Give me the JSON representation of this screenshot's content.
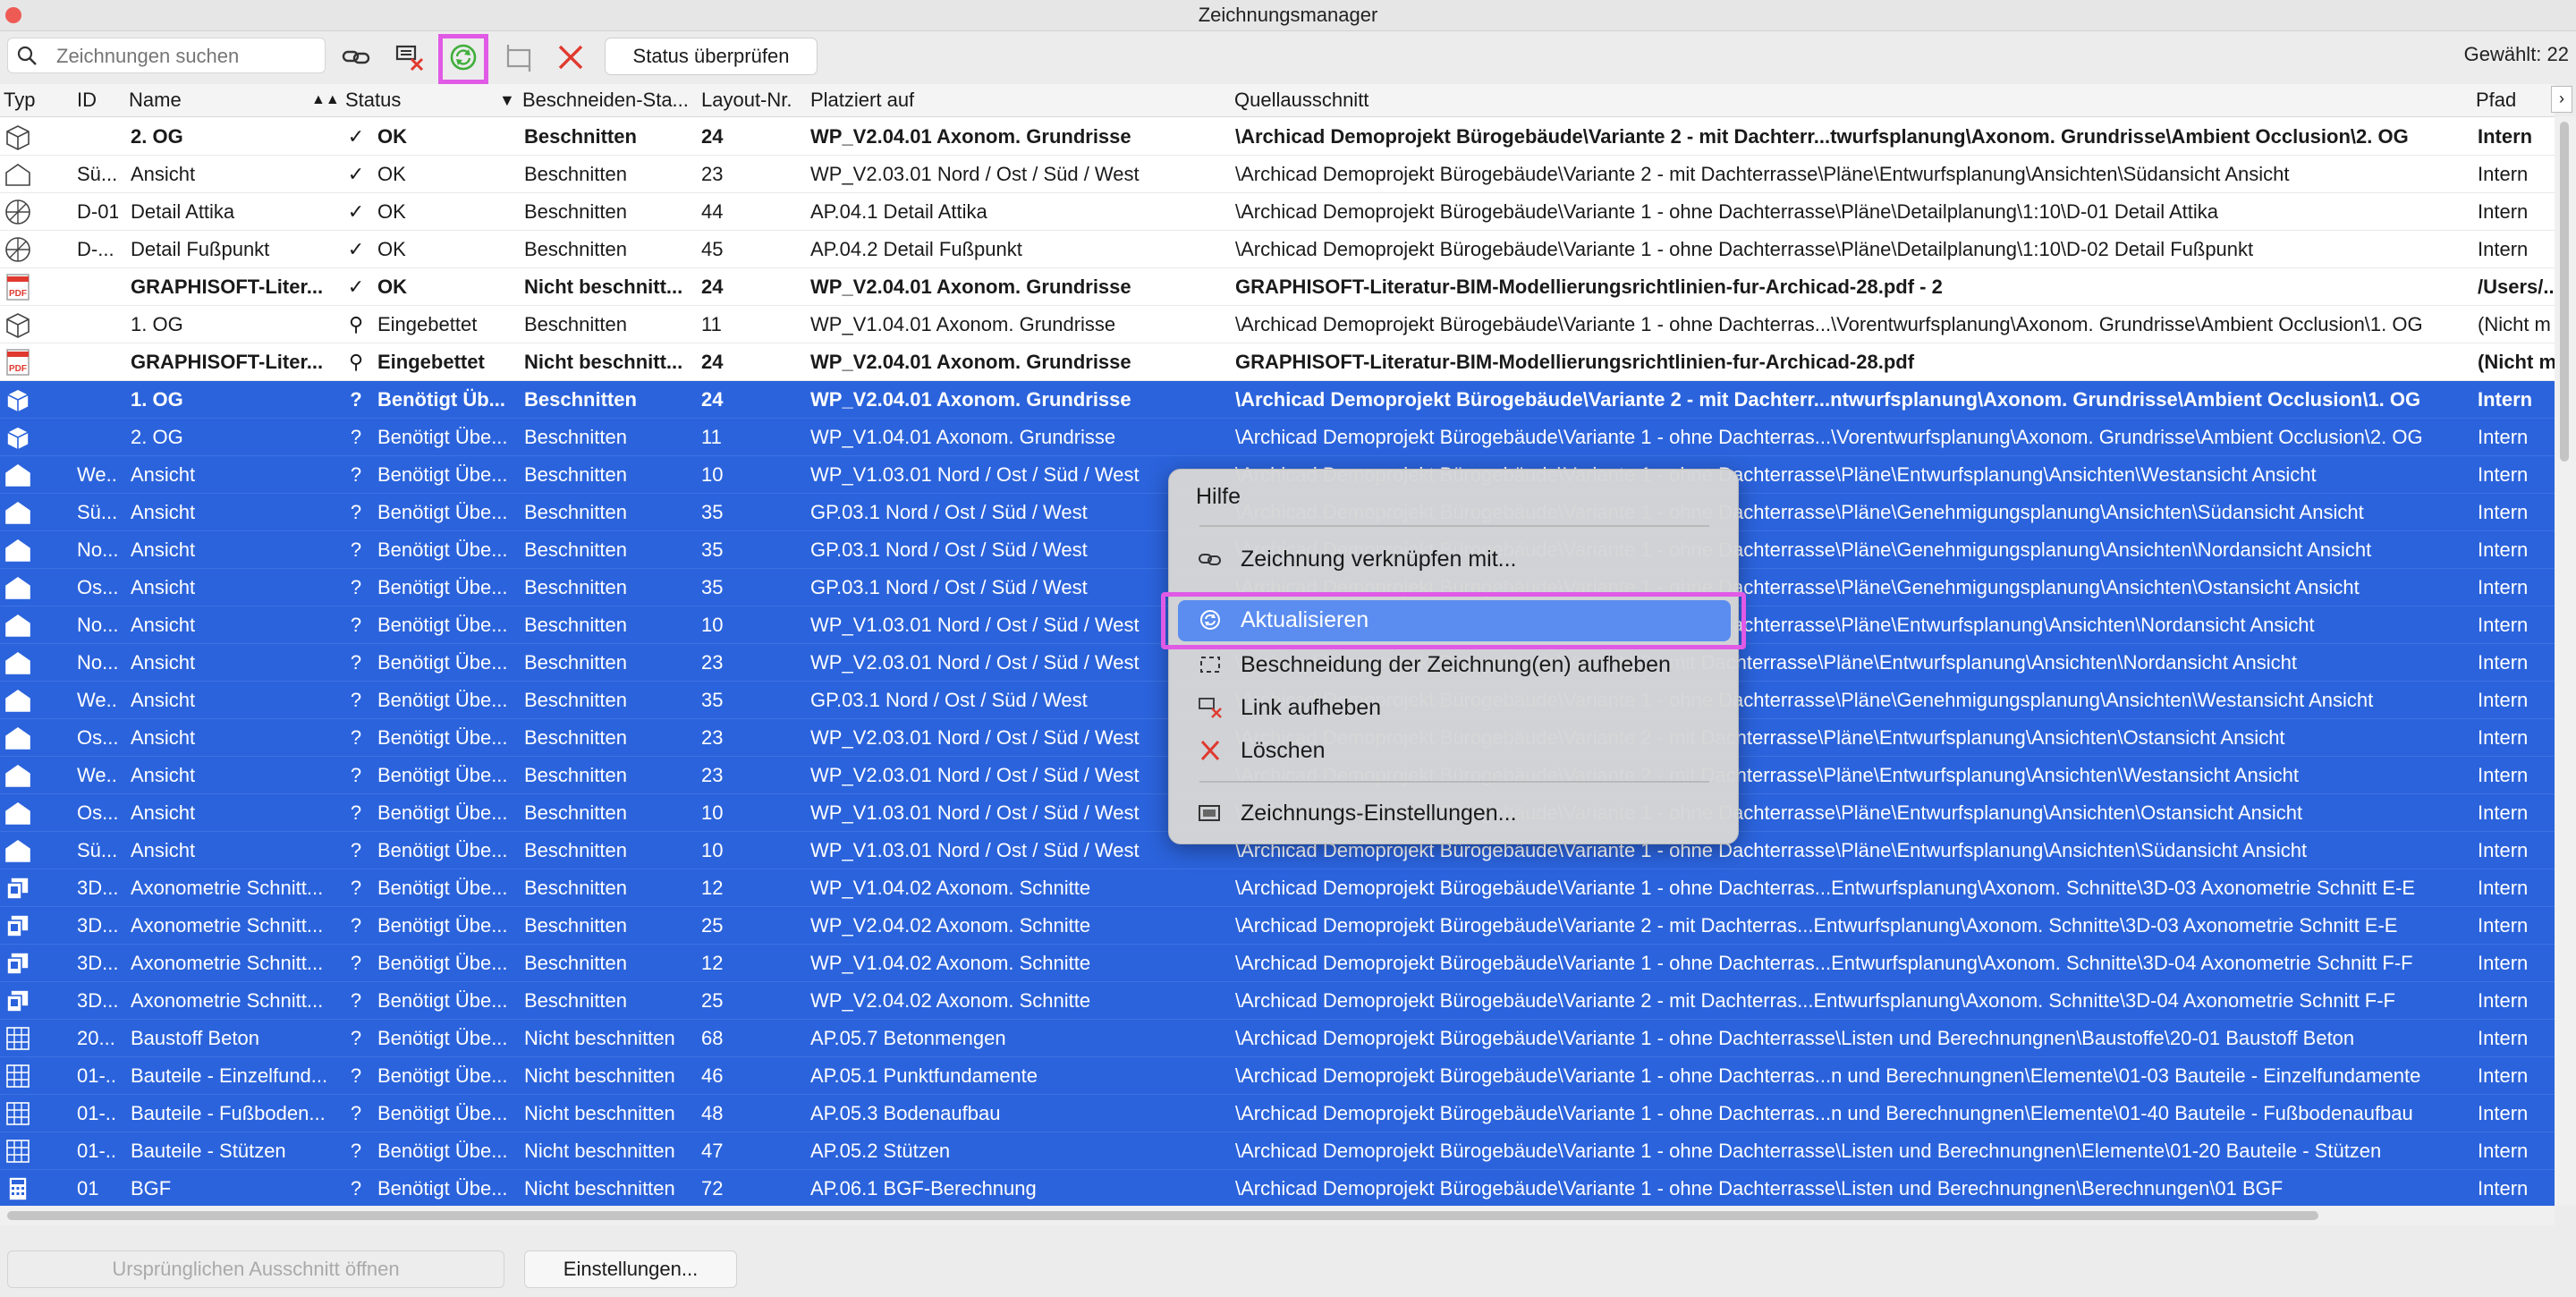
{
  "window": {
    "title": "Zeichnungsmanager"
  },
  "toolbar": {
    "search_placeholder": "Zeichnungen suchen",
    "status_button": "Status überprüfen",
    "selected_label": "Gewählt: 22"
  },
  "columns": {
    "typ": "Typ",
    "id": "ID",
    "name": "Name",
    "status": "Status",
    "beschneiden": "Beschneiden-Sta...",
    "layout": "Layout-Nr.",
    "platziert": "Platziert auf",
    "quelle": "Quellausschnitt",
    "pfad": "Pfad"
  },
  "rows": [
    {
      "type": "axo",
      "id": "",
      "name": "2. OG",
      "st": "check",
      "status": "OK",
      "besch": "Beschnitten",
      "layout": "24",
      "plaz": "WP_V2.04.01 Axonom. Grundrisse",
      "quelle": "\\Archicad Demoprojekt Bürogebäude\\Variante 2 - mit Dachterr...twurfsplanung\\Axonom. Grundrisse\\Ambient Occlusion\\2. OG",
      "pfad": "Intern",
      "bold": true,
      "sel": false
    },
    {
      "type": "elev",
      "id": "Sü...",
      "name": "Ansicht",
      "st": "check",
      "status": "OK",
      "besch": "Beschnitten",
      "layout": "23",
      "plaz": "WP_V2.03.01 Nord / Ost / Süd / West",
      "quelle": "\\Archicad Demoprojekt Bürogebäude\\Variante 2 - mit Dachterrasse\\Pläne\\Entwurfsplanung\\Ansichten\\Südansicht Ansicht",
      "pfad": "Intern",
      "bold": false,
      "sel": false
    },
    {
      "type": "detail",
      "id": "D-01",
      "name": "Detail Attika",
      "st": "check",
      "status": "OK",
      "besch": "Beschnitten",
      "layout": "44",
      "plaz": "AP.04.1 Detail Attika",
      "quelle": "\\Archicad Demoprojekt Bürogebäude\\Variante 1 - ohne Dachterrasse\\Pläne\\Detailplanung\\1:10\\D-01 Detail Attika",
      "pfad": "Intern",
      "bold": false,
      "sel": false
    },
    {
      "type": "detail",
      "id": "D-...",
      "name": "Detail Fußpunkt",
      "st": "check",
      "status": "OK",
      "besch": "Beschnitten",
      "layout": "45",
      "plaz": "AP.04.2 Detail Fußpunkt",
      "quelle": "\\Archicad Demoprojekt Bürogebäude\\Variante 1 - ohne Dachterrasse\\Pläne\\Detailplanung\\1:10\\D-02 Detail Fußpunkt",
      "pfad": "Intern",
      "bold": false,
      "sel": false
    },
    {
      "type": "pdf",
      "id": "",
      "name": "GRAPHISOFT-Liter...",
      "st": "check",
      "status": "OK",
      "besch": "Nicht beschnitt...",
      "layout": "24",
      "plaz": "WP_V2.04.01 Axonom. Grundrisse",
      "quelle": "GRAPHISOFT-Literatur-BIM-Modellierungsrichtlinien-fur-Archicad-28.pdf - 2",
      "pfad": "/Users/...",
      "bold": true,
      "sel": false
    },
    {
      "type": "axo",
      "id": "",
      "name": "1. OG",
      "st": "pin",
      "status": "Eingebettet",
      "besch": "Beschnitten",
      "layout": "11",
      "plaz": "WP_V1.04.01 Axonom. Grundrisse",
      "quelle": "\\Archicad Demoprojekt Bürogebäude\\Variante 1 - ohne Dachterras...\\Vorentwurfsplanung\\Axonom. Grundrisse\\Ambient Occlusion\\1. OG",
      "pfad": "(Nicht m",
      "bold": false,
      "sel": false
    },
    {
      "type": "pdf",
      "id": "",
      "name": "GRAPHISOFT-Liter...",
      "st": "pin",
      "status": "Eingebettet",
      "besch": "Nicht beschnitt...",
      "layout": "24",
      "plaz": "WP_V2.04.01 Axonom. Grundrisse",
      "quelle": "GRAPHISOFT-Literatur-BIM-Modellierungsrichtlinien-fur-Archicad-28.pdf",
      "pfad": "(Nicht m",
      "bold": true,
      "sel": false
    },
    {
      "type": "axo",
      "id": "",
      "name": "1. OG",
      "st": "q",
      "status": "Benötigt Üb...",
      "besch": "Beschnitten",
      "layout": "24",
      "plaz": "WP_V2.04.01 Axonom. Grundrisse",
      "quelle": "\\Archicad Demoprojekt Bürogebäude\\Variante 2 - mit Dachterr...ntwurfsplanung\\Axonom. Grundrisse\\Ambient Occlusion\\1. OG",
      "pfad": "Intern",
      "bold": true,
      "sel": true
    },
    {
      "type": "axo",
      "id": "",
      "name": "2. OG",
      "st": "q",
      "status": "Benötigt Übe...",
      "besch": "Beschnitten",
      "layout": "11",
      "plaz": "WP_V1.04.01 Axonom. Grundrisse",
      "quelle": "\\Archicad Demoprojekt Bürogebäude\\Variante 1 - ohne Dachterras...\\Vorentwurfsplanung\\Axonom. Grundrisse\\Ambient Occlusion\\2. OG",
      "pfad": "Intern",
      "bold": false,
      "sel": true
    },
    {
      "type": "elev",
      "id": "We...",
      "name": "Ansicht",
      "st": "q",
      "status": "Benötigt Übe...",
      "besch": "Beschnitten",
      "layout": "10",
      "plaz": "WP_V1.03.01 Nord / Ost / Süd / West",
      "quelle": "\\Archicad Demoprojekt Bürogebäude\\Variante 1 - ohne Dachterrasse\\Pläne\\Entwurfsplanung\\Ansichten\\Westansicht Ansicht",
      "pfad": "Intern",
      "bold": false,
      "sel": true
    },
    {
      "type": "elev",
      "id": "Sü...",
      "name": "Ansicht",
      "st": "q",
      "status": "Benötigt Übe...",
      "besch": "Beschnitten",
      "layout": "35",
      "plaz": "GP.03.1 Nord / Ost / Süd / West",
      "quelle": "\\Archicad Demoprojekt Bürogebäude\\Variante 1 - ohne Dachterrasse\\Pläne\\Genehmigungsplanung\\Ansichten\\Südansicht Ansicht",
      "pfad": "Intern",
      "bold": false,
      "sel": true
    },
    {
      "type": "elev",
      "id": "No...",
      "name": "Ansicht",
      "st": "q",
      "status": "Benötigt Übe...",
      "besch": "Beschnitten",
      "layout": "35",
      "plaz": "GP.03.1 Nord / Ost / Süd / West",
      "quelle": "\\Archicad Demoprojekt Bürogebäude\\Variante 1 - ohne Dachterrasse\\Pläne\\Genehmigungsplanung\\Ansichten\\Nordansicht Ansicht",
      "pfad": "Intern",
      "bold": false,
      "sel": true
    },
    {
      "type": "elev",
      "id": "Os...",
      "name": "Ansicht",
      "st": "q",
      "status": "Benötigt Übe...",
      "besch": "Beschnitten",
      "layout": "35",
      "plaz": "GP.03.1 Nord / Ost / Süd / West",
      "quelle": "\\Archicad Demoprojekt Bürogebäude\\Variante 1 - ohne Dachterrasse\\Pläne\\Genehmigungsplanung\\Ansichten\\Ostansicht Ansicht",
      "pfad": "Intern",
      "bold": false,
      "sel": true
    },
    {
      "type": "elev",
      "id": "No...",
      "name": "Ansicht",
      "st": "q",
      "status": "Benötigt Übe...",
      "besch": "Beschnitten",
      "layout": "10",
      "plaz": "WP_V1.03.01 Nord / Ost / Süd / West",
      "quelle": "\\Archicad Demoprojekt Bürogebäude\\Variante 1 - ohne Dachterrasse\\Pläne\\Entwurfsplanung\\Ansichten\\Nordansicht Ansicht",
      "pfad": "Intern",
      "bold": false,
      "sel": true
    },
    {
      "type": "elev",
      "id": "No...",
      "name": "Ansicht",
      "st": "q",
      "status": "Benötigt Übe...",
      "besch": "Beschnitten",
      "layout": "23",
      "plaz": "WP_V2.03.01 Nord / Ost / Süd / West",
      "quelle": "\\Archicad Demoprojekt Bürogebäude\\Variante 2 - mit Dachterrasse\\Pläne\\Entwurfsplanung\\Ansichten\\Nordansicht Ansicht",
      "pfad": "Intern",
      "bold": false,
      "sel": true
    },
    {
      "type": "elev",
      "id": "We...",
      "name": "Ansicht",
      "st": "q",
      "status": "Benötigt Übe...",
      "besch": "Beschnitten",
      "layout": "35",
      "plaz": "GP.03.1 Nord / Ost / Süd / West",
      "quelle": "\\Archicad Demoprojekt Bürogebäude\\Variante 1 - ohne Dachterrasse\\Pläne\\Genehmigungsplanung\\Ansichten\\Westansicht Ansicht",
      "pfad": "Intern",
      "bold": false,
      "sel": true
    },
    {
      "type": "elev",
      "id": "Os...",
      "name": "Ansicht",
      "st": "q",
      "status": "Benötigt Übe...",
      "besch": "Beschnitten",
      "layout": "23",
      "plaz": "WP_V2.03.01 Nord / Ost / Süd / West",
      "quelle": "\\Archicad Demoprojekt Bürogebäude\\Variante 2 - mit Dachterrasse\\Pläne\\Entwurfsplanung\\Ansichten\\Ostansicht Ansicht",
      "pfad": "Intern",
      "bold": false,
      "sel": true
    },
    {
      "type": "elev",
      "id": "We...",
      "name": "Ansicht",
      "st": "q",
      "status": "Benötigt Übe...",
      "besch": "Beschnitten",
      "layout": "23",
      "plaz": "WP_V2.03.01 Nord / Ost / Süd / West",
      "quelle": "\\Archicad Demoprojekt Bürogebäude\\Variante 2 - mit Dachterrasse\\Pläne\\Entwurfsplanung\\Ansichten\\Westansicht Ansicht",
      "pfad": "Intern",
      "bold": false,
      "sel": true
    },
    {
      "type": "elev",
      "id": "Os...",
      "name": "Ansicht",
      "st": "q",
      "status": "Benötigt Übe...",
      "besch": "Beschnitten",
      "layout": "10",
      "plaz": "WP_V1.03.01 Nord / Ost / Süd / West",
      "quelle": "\\Archicad Demoprojekt Bürogebäude\\Variante 1 - ohne Dachterrasse\\Pläne\\Entwurfsplanung\\Ansichten\\Ostansicht Ansicht",
      "pfad": "Intern",
      "bold": false,
      "sel": true
    },
    {
      "type": "elev",
      "id": "Sü...",
      "name": "Ansicht",
      "st": "q",
      "status": "Benötigt Übe...",
      "besch": "Beschnitten",
      "layout": "10",
      "plaz": "WP_V1.03.01 Nord / Ost / Süd / West",
      "quelle": "\\Archicad Demoprojekt Bürogebäude\\Variante 1 - ohne Dachterrasse\\Pläne\\Entwurfsplanung\\Ansichten\\Südansicht Ansicht",
      "pfad": "Intern",
      "bold": false,
      "sel": true
    },
    {
      "type": "sect",
      "id": "3D...",
      "name": "Axonometrie Schnitt...",
      "st": "q",
      "status": "Benötigt Übe...",
      "besch": "Beschnitten",
      "layout": "12",
      "plaz": "WP_V1.04.02 Axonom. Schnitte",
      "quelle": "\\Archicad Demoprojekt Bürogebäude\\Variante 1 - ohne Dachterras...Entwurfsplanung\\Axonom. Schnitte\\3D-03 Axonometrie Schnitt E-E",
      "pfad": "Intern",
      "bold": false,
      "sel": true
    },
    {
      "type": "sect",
      "id": "3D...",
      "name": "Axonometrie Schnitt...",
      "st": "q",
      "status": "Benötigt Übe...",
      "besch": "Beschnitten",
      "layout": "25",
      "plaz": "WP_V2.04.02 Axonom. Schnitte",
      "quelle": "\\Archicad Demoprojekt Bürogebäude\\Variante 2 - mit Dachterras...Entwurfsplanung\\Axonom. Schnitte\\3D-03 Axonometrie Schnitt E-E",
      "pfad": "Intern",
      "bold": false,
      "sel": true
    },
    {
      "type": "sect",
      "id": "3D...",
      "name": "Axonometrie Schnitt...",
      "st": "q",
      "status": "Benötigt Übe...",
      "besch": "Beschnitten",
      "layout": "12",
      "plaz": "WP_V1.04.02 Axonom. Schnitte",
      "quelle": "\\Archicad Demoprojekt Bürogebäude\\Variante 1 - ohne Dachterras...Entwurfsplanung\\Axonom. Schnitte\\3D-04 Axonometrie Schnitt F-F",
      "pfad": "Intern",
      "bold": false,
      "sel": true
    },
    {
      "type": "sect",
      "id": "3D...",
      "name": "Axonometrie Schnitt...",
      "st": "q",
      "status": "Benötigt Übe...",
      "besch": "Beschnitten",
      "layout": "25",
      "plaz": "WP_V2.04.02 Axonom. Schnitte",
      "quelle": "\\Archicad Demoprojekt Bürogebäude\\Variante 2 - mit Dachterras...Entwurfsplanung\\Axonom. Schnitte\\3D-04 Axonometrie Schnitt F-F",
      "pfad": "Intern",
      "bold": false,
      "sel": true
    },
    {
      "type": "grid",
      "id": "20...",
      "name": "Baustoff Beton",
      "st": "q",
      "status": "Benötigt Übe...",
      "besch": "Nicht beschnitten",
      "layout": "68",
      "plaz": "AP.05.7 Betonmengen",
      "quelle": "\\Archicad Demoprojekt Bürogebäude\\Variante 1 - ohne Dachterrasse\\Listen und Berechnungnen\\Baustoffe\\20-01 Baustoff Beton",
      "pfad": "Intern",
      "bold": false,
      "sel": true
    },
    {
      "type": "grid",
      "id": "01-...",
      "name": "Bauteile - Einzelfund...",
      "st": "q",
      "status": "Benötigt Übe...",
      "besch": "Nicht beschnitten",
      "layout": "46",
      "plaz": "AP.05.1 Punktfundamente",
      "quelle": "\\Archicad Demoprojekt Bürogebäude\\Variante 1 - ohne Dachterras...n und Berechnungnen\\Elemente\\01-03 Bauteile - Einzelfundamente",
      "pfad": "Intern",
      "bold": false,
      "sel": true
    },
    {
      "type": "grid",
      "id": "01-...",
      "name": "Bauteile - Fußboden...",
      "st": "q",
      "status": "Benötigt Übe...",
      "besch": "Nicht beschnitten",
      "layout": "48",
      "plaz": "AP.05.3 Bodenaufbau",
      "quelle": "\\Archicad Demoprojekt Bürogebäude\\Variante 1 - ohne Dachterras...n und Berechnungnen\\Elemente\\01-40 Bauteile - Fußbodenaufbau",
      "pfad": "Intern",
      "bold": false,
      "sel": true
    },
    {
      "type": "grid",
      "id": "01-...",
      "name": "Bauteile - Stützen",
      "st": "q",
      "status": "Benötigt Übe...",
      "besch": "Nicht beschnitten",
      "layout": "47",
      "plaz": "AP.05.2 Stützen",
      "quelle": "\\Archicad Demoprojekt Bürogebäude\\Variante 1 - ohne Dachterrasse\\Listen und Berechnungnen\\Elemente\\01-20 Bauteile - Stützen",
      "pfad": "Intern",
      "bold": false,
      "sel": true
    },
    {
      "type": "calc",
      "id": "01",
      "name": "BGF",
      "st": "q",
      "status": "Benötigt Übe...",
      "besch": "Nicht beschnitten",
      "layout": "72",
      "plaz": "AP.06.1 BGF-Berechnung",
      "quelle": "\\Archicad Demoprojekt Bürogebäude\\Variante 1 - ohne Dachterrasse\\Listen und Berechnungnen\\Berechnungen\\01 BGF",
      "pfad": "Intern",
      "bold": false,
      "sel": true
    }
  ],
  "context_menu": {
    "help": "Hilfe",
    "link_with": "Zeichnung verknüpfen mit...",
    "update": "Aktualisieren",
    "remove_crop": "Beschneidung der Zeichnung(en) aufheben",
    "unlink": "Link aufheben",
    "delete": "Löschen",
    "settings": "Zeichnungs-Einstellungen..."
  },
  "footer": {
    "open_original": "Ursprünglichen Ausschnitt öffnen",
    "settings": "Einstellungen..."
  },
  "colors": {
    "selection": "#2b63dc",
    "highlight": "#e05ae6",
    "menu_hover": "#5b8df0",
    "delete_red": "#e0392f",
    "update_green": "#3fae3a"
  }
}
